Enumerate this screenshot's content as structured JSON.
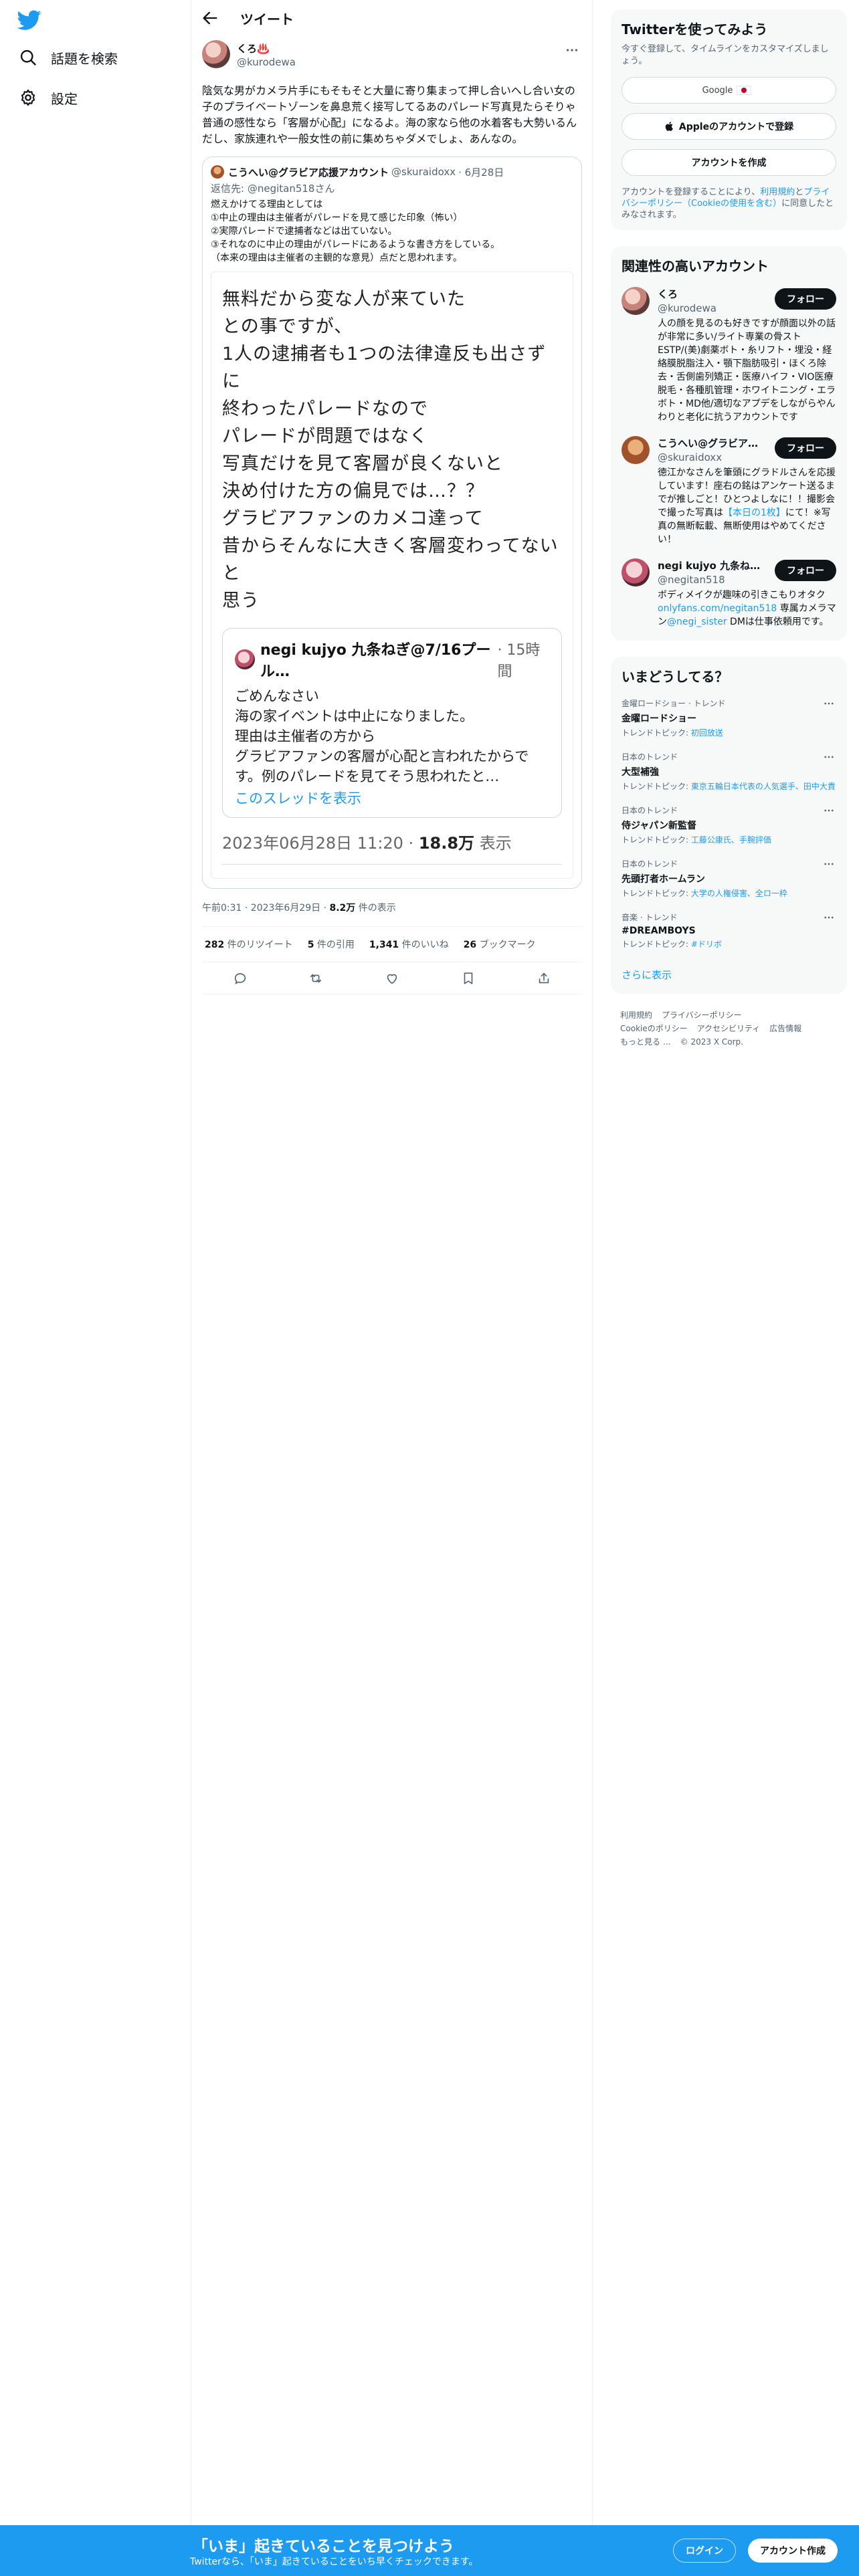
{
  "nav": {
    "logo": "twitter-bird-icon",
    "items": [
      {
        "label": "話題を検索",
        "icon": "search-icon"
      },
      {
        "label": "設定",
        "icon": "gear-icon"
      }
    ]
  },
  "header": {
    "title": "ツイート"
  },
  "tweet": {
    "author_name": "くろ♨️",
    "author_handle": "@kurodewa",
    "text": "陰気な男がカメラ片手にもそもそと大量に寄り集まって押し合いへし合い女の子のプライベートゾーンを鼻息荒く接写してるあのパレード写真見たらそりゃ普通の感性なら「客層が心配」になるよ。海の家なら他の水着客も大勢いるんだし、家族連れや一般女性の前に集めちゃダメでしょ、あんなの。",
    "quote": {
      "name": "こうへい@グラビア応援アカウント",
      "handle": "@skuraidoxx",
      "date": "· 6月28日",
      "reply_prefix": "返信先:",
      "reply_to": "@negitan518さん",
      "body": "燃えかけてる理由としては\n①中止の理由は主催者がパレードを見て感じた印象（怖い）\n②実際パレードで逮捕者などは出ていない。\n③それなのに中止の理由がパレードにあるような書き方をしている。\n（本来の理由は主催者の主観的な意見）点だと思われます。",
      "image": {
        "big_text": "無料だから変な人が来ていた\nとの事ですが、\n1人の逮捕者も1つの法律違反も出さずに\n終わったパレードなので\nパレードが問題ではなく\n写真だけを見て客層が良くないと\n決め付けた方の偏見では…？？\nグラビアファンのカメコ達って\n昔からそんなに大きく客層変わってないと\n思う",
        "inner": {
          "name": "negi kujyo 九条ねぎ@7/16プール…",
          "time": "· 15時間",
          "body": "ごめんなさい\n海の家イベントは中止になりました。\n理由は主催者の方から\nグラビアファンの客層が心配と言われたからで\nす。例のパレードを見てそう思われたと…",
          "link": "このスレッドを表示"
        },
        "meta_date": "2023年06月28日 11:20 · ",
        "meta_views": "18.8万",
        "meta_suffix": " 表示"
      }
    },
    "meta_time": "午前0:31 · 2023年6月29日 · ",
    "meta_views": "8.2万",
    "meta_views_label": " 件の表示",
    "stats": [
      {
        "num": "282",
        "label": " 件のリツイート"
      },
      {
        "num": "5",
        "label": " 件の引用"
      },
      {
        "num": "1,341",
        "label": " 件のいいね"
      },
      {
        "num": "26",
        "label": " ブックマーク"
      }
    ],
    "actions": [
      "reply-icon",
      "retweet-icon",
      "like-icon",
      "bookmark-icon",
      "share-icon"
    ]
  },
  "signup_card": {
    "title": "Twitterを使ってみよう",
    "sub": "今すぐ登録して、タイムラインをカスタマイズしましょう。",
    "google": "Google",
    "apple": "Appleのアカウントで登録",
    "create": "アカウントを作成",
    "legal_pre": "アカウントを登録することにより、",
    "legal_terms": "利用規約",
    "legal_and": "と",
    "legal_privacy": "プライバシーポリシー",
    "legal_cookie": "（Cookieの使用を含む）",
    "legal_post": "に同意したとみなされます。"
  },
  "related": {
    "title": "関連性の高いアカウント",
    "follow_label": "フォロー",
    "people": [
      {
        "name": "くろ",
        "handle": "@kurodewa",
        "bio": "人の顔を見るのも好きですが顔面以外の話が非常に多い/ライト専業の骨ストESTP/(美)劇薬ボト・糸リフト・埋没・経絡膜脱脂注入・顎下脂肪吸引・ほくろ除去・舌側歯列矯正・医療ハイフ・VIO医療脱毛・各種肌管理・ホワイトニング・エラボト・MD他/適切なアプデをしながらやんわりと老化に抗うアカウントです"
      },
      {
        "name": "こうへい@グラビア…",
        "handle": "@skuraidoxx",
        "bio": "徳江かなさんを筆頭にグラドルさんを応援しています！座右の銘はアンケート送るまでが推しごと！ひとつよしなに！！撮影会で撮った写真は",
        "bio_link": "【本日の1枚】",
        "bio_post": "にて！※写真の無断転載、無断使用はやめてください！"
      },
      {
        "name": "negi kujyo 九条ねぎ…",
        "handle": "@negitan518",
        "bio": "ボディメイクが趣味の引きこもりオタク",
        "bio_link": "onlyfans.com/negitan518",
        "bio_mid": " 専属カメラマン",
        "bio_link2": "@negi_sister",
        "bio_post": " DMは仕事依頼用です。"
      }
    ]
  },
  "trends": {
    "title": "いまどうしてる？",
    "items": [
      {
        "context": "金曜ロードショー · トレンド",
        "name": "金曜ロードショー",
        "topic_label": "トレンドトピック: ",
        "topic": "初回放送"
      },
      {
        "context": "日本のトレンド",
        "name": "大型補強",
        "topic_label": "トレンドトピック: ",
        "topic": "東京五輪日本代表の人気選手、田中大貴"
      },
      {
        "context": "日本のトレンド",
        "name": "侍ジャパン新監督",
        "topic_label": "トレンドトピック: ",
        "topic": "工藤公康氏、手腕評価"
      },
      {
        "context": "日本のトレンド",
        "name": "先頭打者ホームラン",
        "topic_label": "トレンドトピック: ",
        "topic": "大学の人権侵害、全ロ一枠"
      },
      {
        "context": "音楽 · トレンド",
        "name": "#DREAMBOYS",
        "topic_label": "トレンドトピック: ",
        "topic": "#ドリボ"
      }
    ],
    "show_more": "さらに表示"
  },
  "footer": [
    "利用規約",
    "プライバシーポリシー",
    "Cookieのポリシー",
    "アクセシビリティ",
    "広告情報",
    "もっと見る …",
    "© 2023 X Corp."
  ],
  "bottom": {
    "title": "「いま」起きていることを見つけよう",
    "sub": "Twitterなら、「いま」起きていることをいち早くチェックできます。",
    "login": "ログイン",
    "signup": "アカウント作成"
  }
}
